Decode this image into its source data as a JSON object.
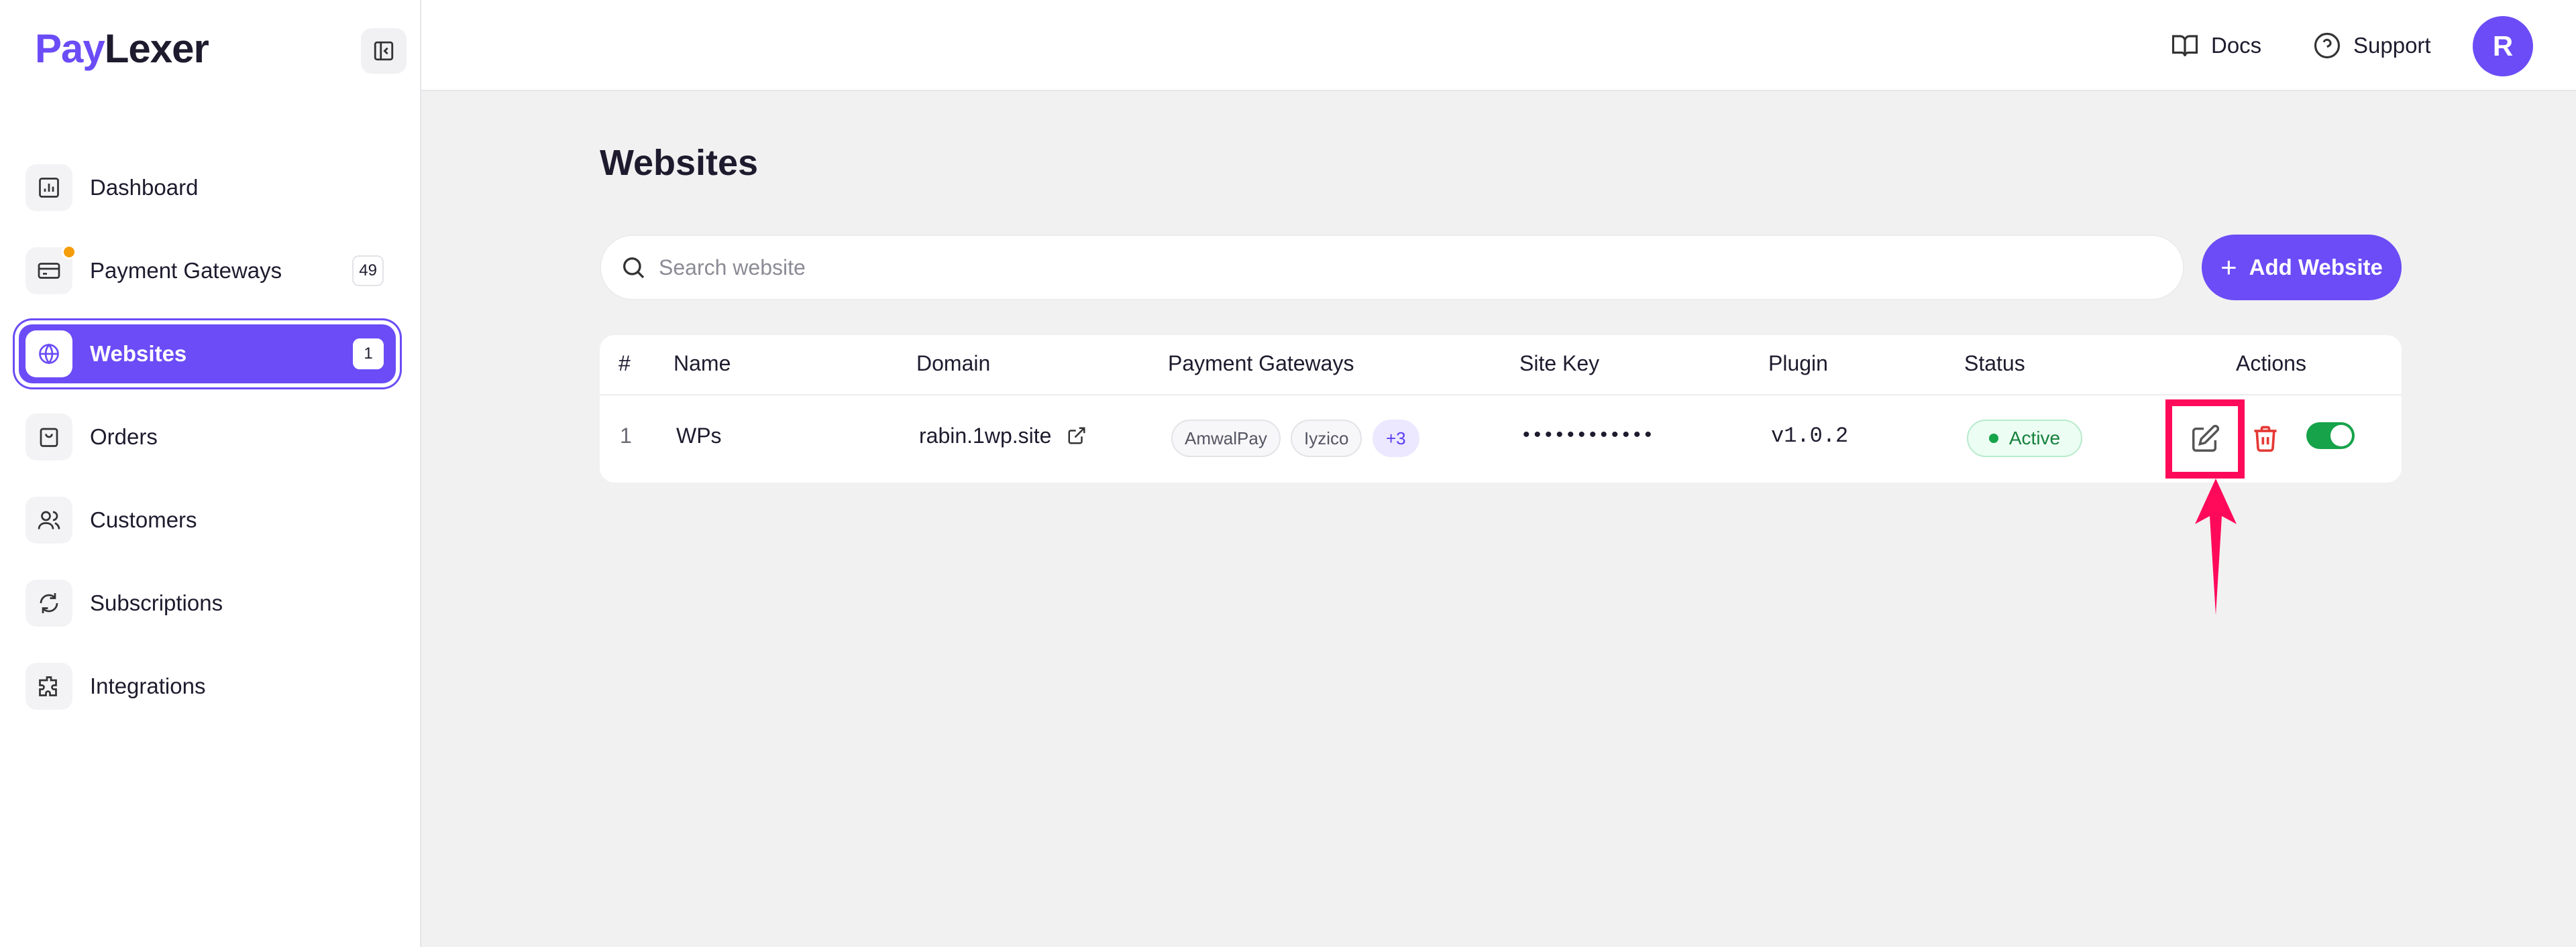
{
  "brand": {
    "part1": "Pay",
    "part2": "Lexer",
    "accent": "#6b4cf6"
  },
  "sidebar": {
    "items": [
      {
        "label": "Dashboard",
        "icon": "bar-chart-icon"
      },
      {
        "label": "Payment Gateways",
        "icon": "credit-card-icon",
        "count": "49",
        "notification": true
      },
      {
        "label": "Websites",
        "icon": "globe-icon",
        "count": "1",
        "active": true
      },
      {
        "label": "Orders",
        "icon": "shopping-bag-icon"
      },
      {
        "label": "Customers",
        "icon": "users-icon"
      },
      {
        "label": "Subscriptions",
        "icon": "refresh-icon"
      },
      {
        "label": "Integrations",
        "icon": "puzzle-icon"
      }
    ]
  },
  "topbar": {
    "docs": "Docs",
    "support": "Support",
    "avatar_initial": "R"
  },
  "main": {
    "title": "Websites",
    "search_placeholder": "Search website",
    "add_button": "Add Website",
    "add_icon": "+"
  },
  "table": {
    "columns": [
      "#",
      "Name",
      "Domain",
      "Payment Gateways",
      "Site Key",
      "Plugin",
      "Status",
      "Actions"
    ],
    "rows": [
      {
        "index": "1",
        "name": "WPs",
        "domain": "rabin.1wp.site",
        "gateways": [
          "AmwalPay",
          "Iyzico"
        ],
        "gateways_more": "+3",
        "site_key": "••••••••••••",
        "plugin": "v1.0.2",
        "status": "Active",
        "enabled": true
      }
    ]
  },
  "colors": {
    "status_active": "#16a34a",
    "danger": "#e53935",
    "highlight": "#ff0a5a"
  }
}
